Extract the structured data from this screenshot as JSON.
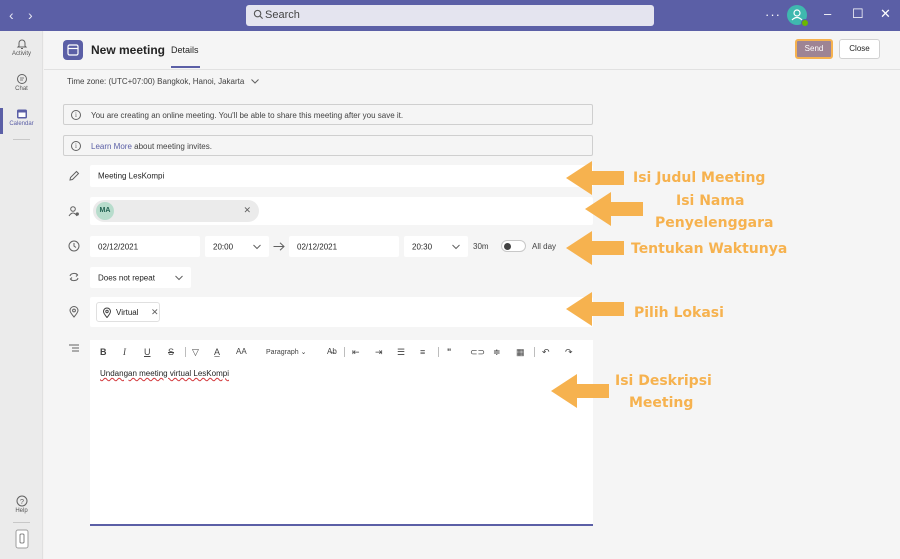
{
  "titlebar": {
    "nav_back": "‹",
    "nav_forward": "›",
    "search_placeholder": "Search",
    "more": "···",
    "minimize": "–",
    "maximize": "☐",
    "close": "✕"
  },
  "rail": {
    "items": [
      {
        "label": "Activity",
        "icon": "bell-icon"
      },
      {
        "label": "Chat",
        "icon": "chat-icon"
      },
      {
        "label": "Calendar",
        "icon": "calendar-icon",
        "active": true
      },
      {
        "label": "Help",
        "icon": "help-icon"
      }
    ]
  },
  "header": {
    "title": "New meeting",
    "tab": "Details",
    "send": "Send",
    "close": "Close"
  },
  "timezone": "Time zone: (UTC+07:00) Bangkok, Hanoi, Jakarta",
  "info": {
    "online_notice": "You are creating an online meeting. You'll be able to share this meeting after you save it.",
    "learn_more_link": "Learn More",
    "learn_more_rest": " about meeting invites."
  },
  "form": {
    "title_value": "Meeting LesKompi",
    "attendee_initials": "MA",
    "start_date": "02/12/2021",
    "start_time": "20:00",
    "end_date": "02/12/2021",
    "end_time": "20:30",
    "duration": "30m",
    "all_day_label": "All day",
    "all_day_on": false,
    "repeat": "Does not repeat",
    "location": "Virtual",
    "paragraph_style": "Paragraph",
    "description": "Undangan meeting virtual LesKompi"
  },
  "annotations": {
    "judul": "Isi Judul Meeting",
    "nama_line1": "Isi Nama",
    "nama_line2": "Penyelenggara",
    "waktu": "Tentukan Waktunya",
    "lokasi": "Pilih Lokasi",
    "deskripsi_line1": "Isi Deskripsi",
    "deskripsi_line2": "Meeting"
  },
  "colors": {
    "brand": "#5b5fa6",
    "annotation": "#f6b24f",
    "send_button": "#9e8494"
  }
}
